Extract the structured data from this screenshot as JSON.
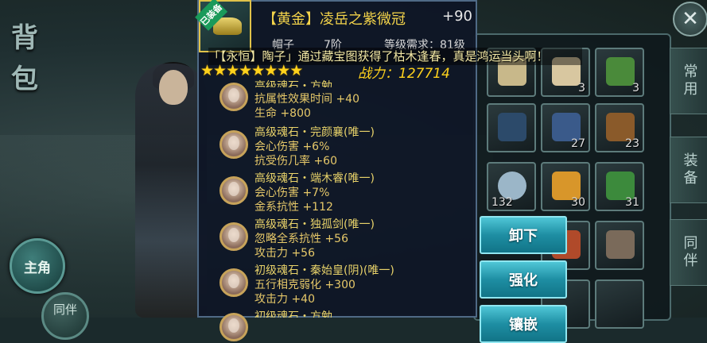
{
  "scene": {
    "side_title": "背包",
    "main_button": "主角",
    "partner_button": "同伴",
    "close_symbol": "✕"
  },
  "tabs": [
    "常用",
    "装备",
    "同伴"
  ],
  "actions": {
    "unequip": "卸下",
    "enhance": "强化",
    "inlay": "镶嵌"
  },
  "item": {
    "equipped_badge": "已装备",
    "title": "【黄金】凌岳之紫微冠",
    "enhance_level": "+90",
    "slot_type": "帽子",
    "tier": "7阶",
    "level_req": "等级需求：81级",
    "stars": "★★★★★★★★",
    "power_label": "战力：",
    "power_value": "127714"
  },
  "broadcast": "「【永恒】陶子」通过藏宝图获得了枯木逢春，真是鸿运当头啊！",
  "gems": [
    {
      "name": "高级魂石・方勉",
      "lines": [
        "抗属性效果时间  +40",
        "生命  +800"
      ]
    },
    {
      "name": "高级魂石・完颜襄(唯一)",
      "lines": [
        "会心伤害  +6%",
        "抗受伤几率  +60"
      ]
    },
    {
      "name": "高级魂石・端木睿(唯一)",
      "lines": [
        "会心伤害  +7%",
        "金系抗性  +112"
      ]
    },
    {
      "name": "高级魂石・独孤剑(唯一)",
      "lines": [
        "忽略全系抗性  +56",
        "攻击力  +56"
      ]
    },
    {
      "name": "初级魂石・秦始皇(阴)(唯一)",
      "lines": [
        "五行相克弱化  +300",
        "攻击力  +40"
      ]
    },
    {
      "name": "初级魂石・方勉",
      "lines": []
    }
  ],
  "bag": {
    "counts": [
      "3",
      "3",
      "27",
      "23",
      "30",
      "31",
      "132"
    ]
  },
  "colors": {
    "gold_text": "#f3d34a",
    "button_cyan": "#1e8ea3",
    "star": "#ffd21c"
  }
}
